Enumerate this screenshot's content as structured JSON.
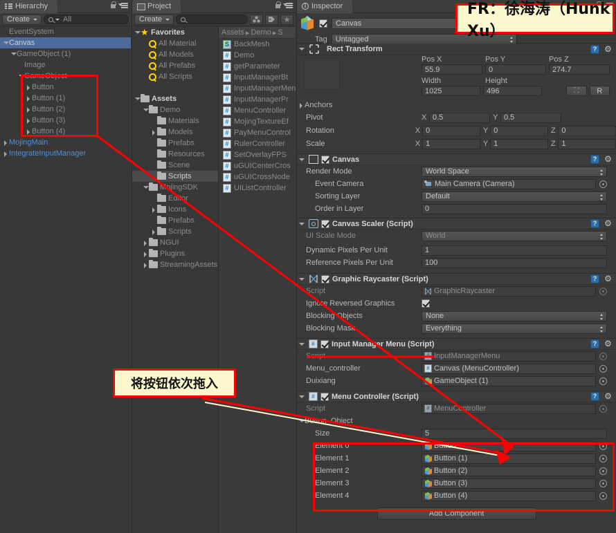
{
  "hierarchy": {
    "tab_label": "Hierarchy",
    "create_label": "Create",
    "search_placeholder": "All",
    "items": [
      {
        "label": "EventSystem",
        "indent": 0,
        "tri": "none",
        "style": "dim"
      },
      {
        "label": "Canvas",
        "indent": 0,
        "tri": "down",
        "style": "selected"
      },
      {
        "label": "GameObject (1)",
        "indent": 1,
        "tri": "down",
        "style": "dim"
      },
      {
        "label": "Image",
        "indent": 2,
        "tri": "none",
        "style": "dim"
      },
      {
        "label": "GameObject",
        "indent": 2,
        "tri": "down",
        "style": "dim"
      },
      {
        "label": "Button",
        "indent": 3,
        "tri": "right",
        "style": "dim"
      },
      {
        "label": "Button (1)",
        "indent": 3,
        "tri": "right",
        "style": "dim"
      },
      {
        "label": "Button (2)",
        "indent": 3,
        "tri": "right",
        "style": "dim"
      },
      {
        "label": "Button (3)",
        "indent": 3,
        "tri": "right",
        "style": "dim"
      },
      {
        "label": "Button (4)",
        "indent": 3,
        "tri": "right",
        "style": "dim"
      },
      {
        "label": "MojingMain",
        "indent": 0,
        "tri": "right",
        "style": "blue"
      },
      {
        "label": "IntegrateInputManager",
        "indent": 0,
        "tri": "right",
        "style": "blue"
      }
    ]
  },
  "project": {
    "tab_label": "Project",
    "create_label": "Create",
    "search_placeholder": "",
    "breadcrumb": [
      "Assets",
      "Demo",
      "S"
    ],
    "tree": [
      {
        "label": "Favorites",
        "indent": 0,
        "tri": "down",
        "icon": "star-icon",
        "bold": true
      },
      {
        "label": "All Material",
        "indent": 1,
        "tri": "none",
        "icon": "search-yellow-icon"
      },
      {
        "label": "All Models",
        "indent": 1,
        "tri": "none",
        "icon": "search-yellow-icon"
      },
      {
        "label": "All Prefabs",
        "indent": 1,
        "tri": "none",
        "icon": "search-yellow-icon"
      },
      {
        "label": "All Scripts",
        "indent": 1,
        "tri": "none",
        "icon": "search-yellow-icon"
      },
      {
        "label": "",
        "indent": 0,
        "tri": "none",
        "icon": "none"
      },
      {
        "label": "Assets",
        "indent": 0,
        "tri": "down",
        "icon": "folder-icon",
        "bold": true
      },
      {
        "label": "Demo",
        "indent": 1,
        "tri": "down",
        "icon": "folder-icon"
      },
      {
        "label": "Materials",
        "indent": 2,
        "tri": "none",
        "icon": "folder-icon"
      },
      {
        "label": "Models",
        "indent": 2,
        "tri": "right",
        "icon": "folder-icon"
      },
      {
        "label": "Prefabs",
        "indent": 2,
        "tri": "none",
        "icon": "folder-icon"
      },
      {
        "label": "Resources",
        "indent": 2,
        "tri": "none",
        "icon": "folder-icon"
      },
      {
        "label": "Scene",
        "indent": 2,
        "tri": "none",
        "icon": "folder-icon"
      },
      {
        "label": "Scripts",
        "indent": 2,
        "tri": "none",
        "icon": "folder-icon",
        "selected": true
      },
      {
        "label": "MojingSDK",
        "indent": 1,
        "tri": "down",
        "icon": "folder-icon"
      },
      {
        "label": "Editor",
        "indent": 2,
        "tri": "none",
        "icon": "folder-icon"
      },
      {
        "label": "Icons",
        "indent": 2,
        "tri": "right",
        "icon": "folder-icon"
      },
      {
        "label": "Prefabs",
        "indent": 2,
        "tri": "none",
        "icon": "folder-icon"
      },
      {
        "label": "Scripts",
        "indent": 2,
        "tri": "right",
        "icon": "folder-icon"
      },
      {
        "label": "NGUI",
        "indent": 1,
        "tri": "right",
        "icon": "folder-icon"
      },
      {
        "label": "Plugins",
        "indent": 1,
        "tri": "right",
        "icon": "folder-icon"
      },
      {
        "label": "StreamingAssets",
        "indent": 1,
        "tri": "right",
        "icon": "folder-icon"
      }
    ],
    "files": [
      {
        "label": "BackMesh",
        "icon": "shader-icon"
      },
      {
        "label": "Demo",
        "icon": "csharp-icon"
      },
      {
        "label": "getParameter",
        "icon": "csharp-icon"
      },
      {
        "label": "InputManagerBt",
        "icon": "csharp-icon"
      },
      {
        "label": "InputManagerMenu",
        "icon": "csharp-icon"
      },
      {
        "label": "InputManagerPr",
        "icon": "csharp-icon"
      },
      {
        "label": "MenuController",
        "icon": "csharp-icon"
      },
      {
        "label": "MojingTextureEf",
        "icon": "csharp-icon"
      },
      {
        "label": "PayMenuControl",
        "icon": "csharp-icon"
      },
      {
        "label": "RulerController",
        "icon": "csharp-icon"
      },
      {
        "label": "SetOverlayFPS",
        "icon": "csharp-icon"
      },
      {
        "label": "uGUICenterCros",
        "icon": "csharp-icon"
      },
      {
        "label": "uGUICrossNode",
        "icon": "csharp-icon"
      },
      {
        "label": "UIListController",
        "icon": "csharp-icon"
      }
    ]
  },
  "inspector": {
    "tab_label": "Inspector",
    "object_name": "Canvas",
    "object_enabled": true,
    "tag_label": "Tag",
    "tag_value": "Untagged",
    "rect_transform": {
      "title": "Rect Transform",
      "pos_x_label": "Pos X",
      "pos_x": "55.9",
      "pos_y_label": "Pos Y",
      "pos_y": "0",
      "pos_z_label": "Pos Z",
      "pos_z": "274.7",
      "width_label": "Width",
      "width": "1025",
      "height_label": "Height",
      "height": "496",
      "blueprint_label": "R",
      "anchors_label": "Anchors",
      "pivot_label": "Pivot",
      "pivot_x": "0.5",
      "pivot_y": "0.5",
      "rotation_label": "Rotation",
      "rot_x": "0",
      "rot_y": "0",
      "rot_z": "0",
      "scale_label": "Scale",
      "scale_x": "1",
      "scale_y": "1",
      "scale_z": "1"
    },
    "canvas": {
      "title": "Canvas",
      "enabled": true,
      "render_mode_label": "Render Mode",
      "render_mode": "World Space",
      "event_camera_label": "Event Camera",
      "event_camera": "Main Camera (Camera)",
      "sorting_layer_label": "Sorting Layer",
      "sorting_layer": "Default",
      "order_in_layer_label": "Order in Layer",
      "order_in_layer": "0"
    },
    "canvas_scaler": {
      "title": "Canvas Scaler (Script)",
      "enabled": true,
      "ui_scale_mode_label": "UI Scale Mode",
      "ui_scale_mode": "World",
      "dynamic_ppu_label": "Dynamic Pixels Per Unit",
      "dynamic_ppu": "1",
      "reference_ppu_label": "Reference Pixels Per Unit",
      "reference_ppu": "100"
    },
    "graphic_raycaster": {
      "title": "Graphic Raycaster (Script)",
      "enabled": true,
      "script_label": "Script",
      "script_value": "GraphicRaycaster",
      "ignore_reversed_label": "Ignore Reversed Graphics",
      "ignore_reversed": true,
      "blocking_objects_label": "Blocking Objects",
      "blocking_objects": "None",
      "blocking_mask_label": "Blocking Mask",
      "blocking_mask": "Everything"
    },
    "input_manager_menu": {
      "title": "Input Manager Menu (Script)",
      "enabled": true,
      "script_label": "Script",
      "script_value": "InputManagerMenu",
      "menu_controller_label": "Menu_controller",
      "menu_controller_value": "Canvas (MenuController)",
      "duixiang_label": "Duixiang",
      "duixiang_value": "GameObject (1)"
    },
    "menu_controller": {
      "title": "Menu Controller (Script)",
      "enabled": true,
      "script_label": "Script",
      "script_value": "MenuController",
      "array_label": "Button_Object",
      "size_label": "Size",
      "size_value": "5",
      "elements": [
        {
          "label": "Element 0",
          "value": "Button"
        },
        {
          "label": "Element 1",
          "value": "Button (1)"
        },
        {
          "label": "Element 2",
          "value": "Button (2)"
        },
        {
          "label": "Element 3",
          "value": "Button (3)"
        },
        {
          "label": "Element 4",
          "value": "Button (4)"
        }
      ]
    },
    "add_component_label": "Add Component"
  },
  "annotations": {
    "fr_banner": "FR：徐海涛（Hunk Xu）",
    "callout_text": "将按钮依次拖入",
    "accent_red": "#ff0000",
    "callout_bg": "#fdf7cd"
  }
}
